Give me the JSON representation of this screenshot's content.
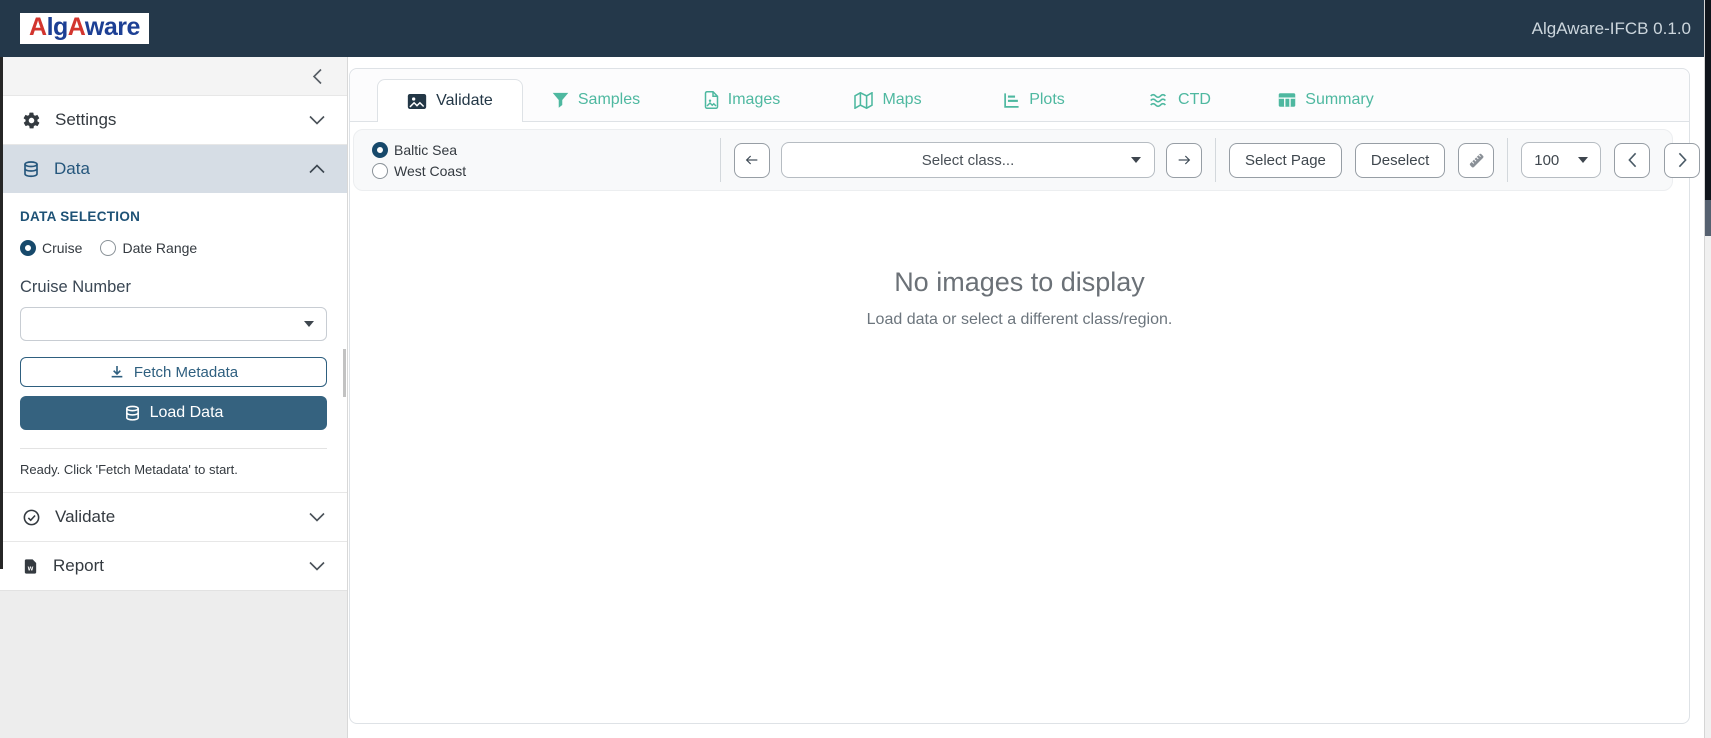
{
  "navbar": {
    "logo": {
      "p1": "A",
      "p2": "lg",
      "p3": "A",
      "p4": "ware"
    },
    "version": "AlgAware-IFCB 0.1.0"
  },
  "sidebar": {
    "settings_label": "Settings",
    "data_label": "Data",
    "validate_label": "Validate",
    "report_label": "Report",
    "data_panel": {
      "section_title": "DATA SELECTION",
      "radio_cruise": "Cruise",
      "radio_date_range": "Date Range",
      "cruise_number_label": "Cruise Number",
      "cruise_number_value": "",
      "fetch_button": "Fetch Metadata",
      "load_button": "Load Data",
      "status": "Ready. Click 'Fetch Metadata' to start."
    }
  },
  "tabs": [
    {
      "label": "Validate",
      "icon": "image-icon",
      "active": true
    },
    {
      "label": "Samples",
      "icon": "filter-icon",
      "active": false
    },
    {
      "label": "Images",
      "icon": "file-image-icon",
      "active": false
    },
    {
      "label": "Maps",
      "icon": "map-icon",
      "active": false
    },
    {
      "label": "Plots",
      "icon": "chart-icon",
      "active": false
    },
    {
      "label": "CTD",
      "icon": "waves-icon",
      "active": false
    },
    {
      "label": "Summary",
      "icon": "table-icon",
      "active": false
    }
  ],
  "toolbar": {
    "region_baltic": "Baltic Sea",
    "region_west_coast": "West Coast",
    "prev_class_icon": "arrow-left-icon",
    "class_select_placeholder": "Select class...",
    "next_class_icon": "arrow-right-icon",
    "select_page_button": "Select Page",
    "deselect_button": "Deselect",
    "label_tool_icon": "ruler-icon",
    "page_size_value": "100",
    "prev_page_icon": "chevron-left-icon",
    "next_page_icon": "chevron-right-icon"
  },
  "empty_state": {
    "title": "No images to display",
    "subtitle": "Load data or select a different class/region."
  },
  "colors": {
    "navbar_bg": "#24384a",
    "primary": "#2e5f7f",
    "primary_fill": "#35627f",
    "active_item_bg": "#d6dde5",
    "tab_teal": "#4eb8a0",
    "logo_red": "#d2352e",
    "logo_blue": "#1c3f94"
  }
}
